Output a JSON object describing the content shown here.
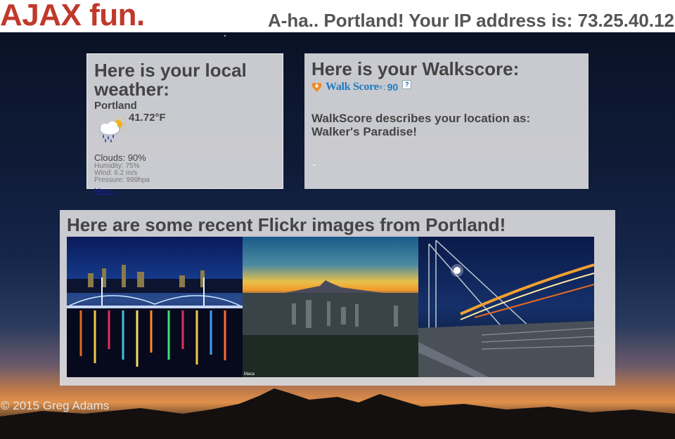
{
  "header": {
    "logo": "AJAX fun.",
    "ip_message": "A-ha.. Portland! Your IP address is: 73.25.40.12"
  },
  "weather": {
    "heading": "Here is your local weather:",
    "city": "Portland",
    "temperature": "41.72°F",
    "icon": "rain-cloud-sun-icon",
    "clouds": "Clouds: 90%",
    "humidity": "Humidity: 75%",
    "wind": "Wind: 6.2 m/s",
    "pressure": "Pressure: 999hpa",
    "more_link": "More.."
  },
  "walkscore": {
    "heading": "Here is your Walkscore:",
    "brand": "Walk Score",
    "reg_mark": "®",
    "separator": ":",
    "score": "90",
    "help": "?",
    "description": "WalkScore describes your location as: Walker's Paradise!"
  },
  "flickr": {
    "heading": "Here are some recent Flickr images from Portland!",
    "images": [
      "night-bridge-reflection-photo",
      "mount-hood-sunset-city-photo",
      "light-trails-bridge-photo"
    ],
    "watermark": "Maca"
  },
  "footer": {
    "copyright": "© 2015 Greg Adams"
  },
  "colors": {
    "logo": "#c0392b",
    "header_text": "#555555",
    "walkscore_blue": "#1f7bbf",
    "panel_bg": "#d8d8dc"
  }
}
